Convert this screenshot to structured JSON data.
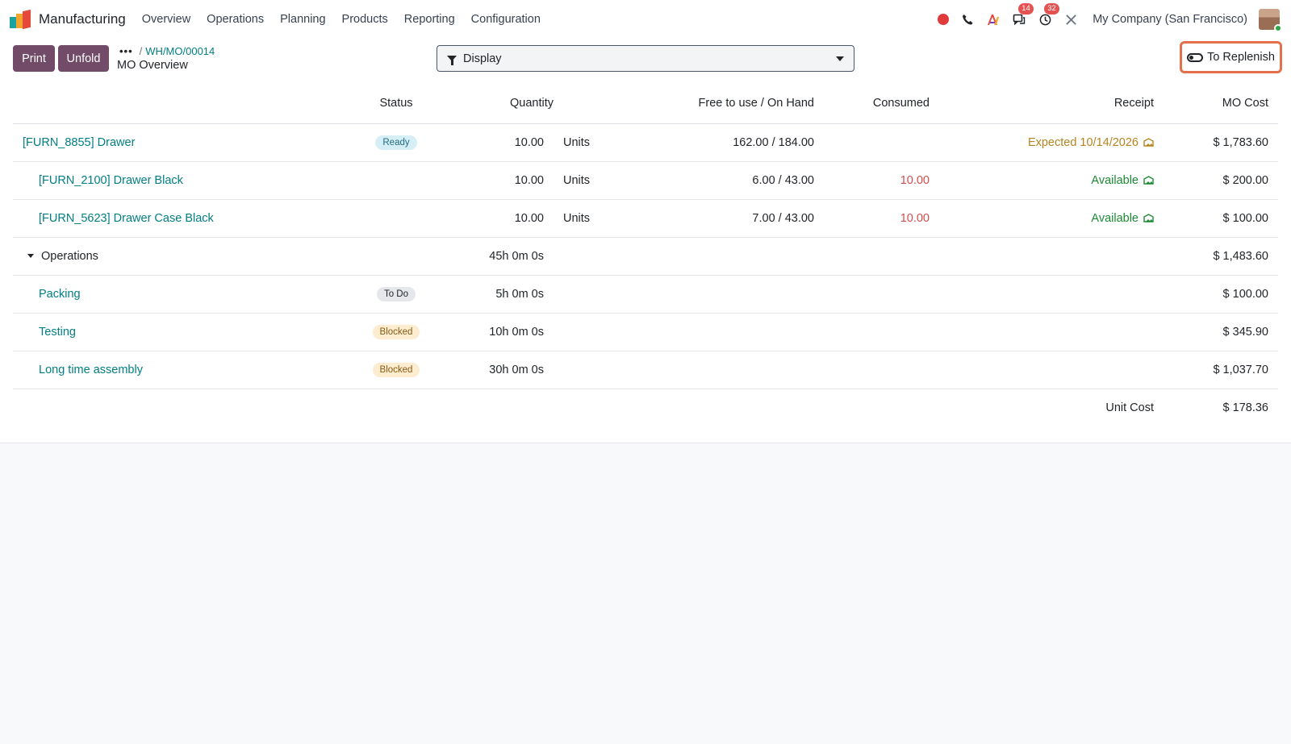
{
  "nav": {
    "app_name": "Manufacturing",
    "menu": [
      "Overview",
      "Operations",
      "Planning",
      "Products",
      "Reporting",
      "Configuration"
    ],
    "messages_count": "14",
    "activities_count": "32",
    "company": "My Company (San Francisco)"
  },
  "control": {
    "print_label": "Print",
    "unfold_label": "Unfold",
    "breadcrumb_dots": "•••",
    "breadcrumb_record": "WH/MO/00014",
    "page_title": "MO Overview",
    "display_label": "Display",
    "replenish_label": "To Replenish"
  },
  "table": {
    "headers": {
      "status": "Status",
      "quantity": "Quantity",
      "free_on_hand": "Free to use / On Hand",
      "consumed": "Consumed",
      "receipt": "Receipt",
      "mo_cost": "MO Cost"
    },
    "main": {
      "name": "[FURN_8855] Drawer",
      "status": "Ready",
      "quantity": "10.00",
      "uom": "Units",
      "free_on_hand": "162.00 / 184.00",
      "receipt": "Expected 10/14/2026",
      "cost": "$ 1,783.60"
    },
    "components": [
      {
        "name": "[FURN_2100] Drawer Black",
        "quantity": "10.00",
        "uom": "Units",
        "free_on_hand": "6.00 / 43.00",
        "consumed": "10.00",
        "receipt": "Available",
        "cost": "$ 200.00"
      },
      {
        "name": "[FURN_5623] Drawer Case Black",
        "quantity": "10.00",
        "uom": "Units",
        "free_on_hand": "7.00 / 43.00",
        "consumed": "10.00",
        "receipt": "Available",
        "cost": "$ 100.00"
      }
    ],
    "operations_group": {
      "label": "Operations",
      "duration": "45h 0m 0s",
      "cost": "$ 1,483.60"
    },
    "operations": [
      {
        "name": "Packing",
        "status": "To Do",
        "duration": "5h 0m 0s",
        "cost": "$ 100.00"
      },
      {
        "name": "Testing",
        "status": "Blocked",
        "duration": "10h 0m 0s",
        "cost": "$ 345.90"
      },
      {
        "name": "Long time assembly",
        "status": "Blocked",
        "duration": "30h 0m 0s",
        "cost": "$ 1,037.70"
      }
    ],
    "unit_cost_label": "Unit Cost",
    "unit_cost": "$ 178.36"
  },
  "icons": [
    "app-logo-icon",
    "record-icon",
    "phone-icon",
    "ai-icon",
    "chat-icon",
    "clock-icon",
    "tools-icon",
    "filter-icon",
    "toggle-icon",
    "receipt-icon",
    "caret-down-icon"
  ],
  "colors": {
    "primary": "#714b67",
    "link": "#017e84",
    "danger": "#d44c4c",
    "warning": "#b58420",
    "success": "#1c8a34",
    "highlight": "#e3704a"
  }
}
